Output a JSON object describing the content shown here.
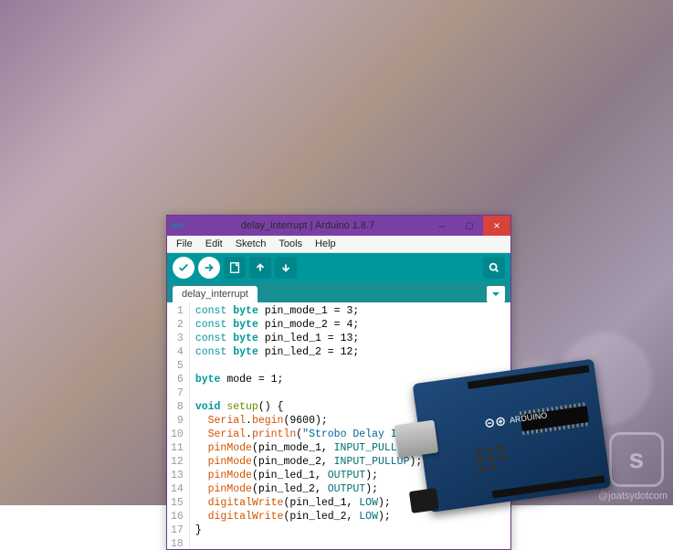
{
  "titlebar": {
    "title": "delay_interrupt | Arduino 1.8.7",
    "minimize": "–",
    "maximize": "□",
    "close": "×"
  },
  "menu": [
    "File",
    "Edit",
    "Sketch",
    "Tools",
    "Help"
  ],
  "toolbar": {
    "verify": "verify",
    "upload": "upload",
    "new": "new",
    "open": "open",
    "save": "save",
    "serial": "serial-monitor"
  },
  "tab": {
    "label": "delay_interrupt"
  },
  "code_lines": [
    {
      "n": 1,
      "tokens": [
        [
          "const",
          "kw"
        ],
        [
          " ",
          ""
        ],
        [
          "byte",
          "type"
        ],
        [
          " pin_mode_1 = ",
          ""
        ],
        [
          "3",
          ""
        ],
        [
          ";",
          ""
        ]
      ]
    },
    {
      "n": 2,
      "tokens": [
        [
          "const",
          "kw"
        ],
        [
          " ",
          ""
        ],
        [
          "byte",
          "type"
        ],
        [
          " pin_mode_2 = ",
          ""
        ],
        [
          "4",
          ""
        ],
        [
          ";",
          ""
        ]
      ]
    },
    {
      "n": 3,
      "tokens": [
        [
          "const",
          "kw"
        ],
        [
          " ",
          ""
        ],
        [
          "byte",
          "type"
        ],
        [
          " pin_led_1 = ",
          ""
        ],
        [
          "13",
          ""
        ],
        [
          ";",
          ""
        ]
      ]
    },
    {
      "n": 4,
      "tokens": [
        [
          "const",
          "kw"
        ],
        [
          " ",
          ""
        ],
        [
          "byte",
          "type"
        ],
        [
          " pin_led_2 = ",
          ""
        ],
        [
          "12",
          ""
        ],
        [
          ";",
          ""
        ]
      ]
    },
    {
      "n": 5,
      "tokens": [
        [
          "",
          ""
        ]
      ]
    },
    {
      "n": 6,
      "tokens": [
        [
          "byte",
          "type"
        ],
        [
          " mode = ",
          ""
        ],
        [
          "1",
          ""
        ],
        [
          ";",
          ""
        ]
      ]
    },
    {
      "n": 7,
      "tokens": [
        [
          "",
          ""
        ]
      ]
    },
    {
      "n": 8,
      "tokens": [
        [
          "void",
          "type"
        ],
        [
          " ",
          ""
        ],
        [
          "setup",
          "ctrl"
        ],
        [
          "() {",
          ""
        ]
      ]
    },
    {
      "n": 9,
      "tokens": [
        [
          "  ",
          ""
        ],
        [
          "Serial",
          "fn"
        ],
        [
          ".",
          ""
        ],
        [
          "begin",
          "fn"
        ],
        [
          "(9600);",
          ""
        ]
      ]
    },
    {
      "n": 10,
      "tokens": [
        [
          "  ",
          ""
        ],
        [
          "Serial",
          "fn"
        ],
        [
          ".",
          ""
        ],
        [
          "println",
          "fn"
        ],
        [
          "(",
          ""
        ],
        [
          "\"Strobo Delay Interrupt\"",
          "str"
        ],
        [
          ");",
          ""
        ]
      ]
    },
    {
      "n": 11,
      "tokens": [
        [
          "  ",
          ""
        ],
        [
          "pinMode",
          "fn"
        ],
        [
          "(pin_mode_1, ",
          ""
        ],
        [
          "INPUT_PULLUP",
          "const"
        ],
        [
          ");",
          ""
        ]
      ]
    },
    {
      "n": 12,
      "tokens": [
        [
          "  ",
          ""
        ],
        [
          "pinMode",
          "fn"
        ],
        [
          "(pin_mode_2, ",
          ""
        ],
        [
          "INPUT_PULLUP",
          "const"
        ],
        [
          ");",
          ""
        ]
      ]
    },
    {
      "n": 13,
      "tokens": [
        [
          "  ",
          ""
        ],
        [
          "pinMode",
          "fn"
        ],
        [
          "(pin_led_1, ",
          ""
        ],
        [
          "OUTPUT",
          "const"
        ],
        [
          ");",
          ""
        ]
      ]
    },
    {
      "n": 14,
      "tokens": [
        [
          "  ",
          ""
        ],
        [
          "pinMode",
          "fn"
        ],
        [
          "(pin_led_2, ",
          ""
        ],
        [
          "OUTPUT",
          "const"
        ],
        [
          ");",
          ""
        ]
      ]
    },
    {
      "n": 15,
      "tokens": [
        [
          "  ",
          ""
        ],
        [
          "digitalWrite",
          "fn"
        ],
        [
          "(pin_led_1, ",
          ""
        ],
        [
          "LOW",
          "const"
        ],
        [
          ");",
          ""
        ]
      ]
    },
    {
      "n": 16,
      "tokens": [
        [
          "  ",
          ""
        ],
        [
          "digitalWrite",
          "fn"
        ],
        [
          "(pin_led_2, ",
          ""
        ],
        [
          "LOW",
          "const"
        ],
        [
          ");",
          ""
        ]
      ]
    },
    {
      "n": 17,
      "tokens": [
        [
          "}",
          ""
        ]
      ]
    },
    {
      "n": 18,
      "tokens": [
        [
          "",
          ""
        ]
      ]
    }
  ],
  "watermark": "@joatsydotcom",
  "board_label": "ARDUINO"
}
